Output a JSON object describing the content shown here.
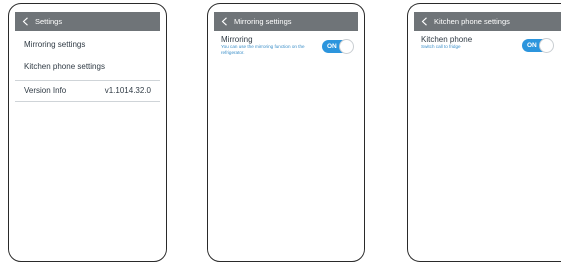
{
  "screens": [
    {
      "title": "Settings",
      "items": [
        "Mirroring settings",
        "Kitchen phone settings"
      ],
      "version_label": "Version Info",
      "version_value": "v1.1014.32.0"
    },
    {
      "title": "Mirroring settings",
      "setting_title": "Mirroring",
      "setting_desc": "You can use the mirroring function on the refrigerator.",
      "toggle_label": "ON"
    },
    {
      "title": "Kitchen phone settings",
      "setting_title": "Kitchen phone",
      "setting_desc": "Switch call to fridge",
      "toggle_label": "ON"
    }
  ],
  "colors": {
    "titlebar": "#6f7478",
    "toggle_on": "#2c95dd",
    "description_text": "#3a8ec8"
  },
  "icons": [
    "chevron-left-icon"
  ]
}
